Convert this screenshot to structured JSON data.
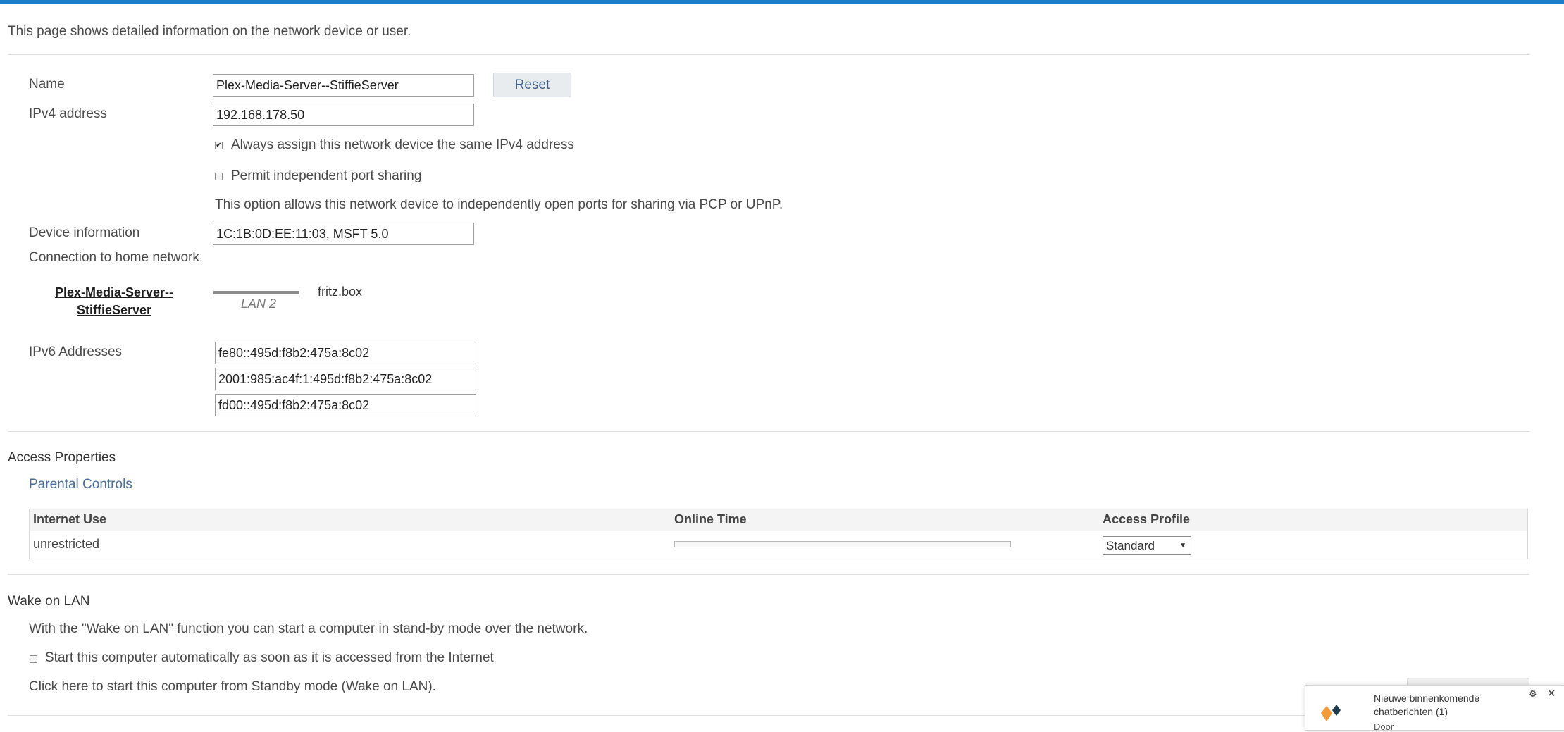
{
  "intro": "This page shows detailed information on the network device or user.",
  "name": {
    "label": "Name",
    "value": "Plex-Media-Server--StiffieServer",
    "reset_label": "Reset"
  },
  "ipv4": {
    "label": "IPv4 address",
    "value": "192.168.178.50",
    "always_assign_label": "Always assign this network device the same IPv4 address",
    "always_assign_checked": true,
    "permit_sharing_label": "Permit independent port sharing",
    "permit_sharing_checked": false,
    "permit_sharing_help": "This option allows this network device to independently open ports for sharing via PCP or UPnP."
  },
  "device_info": {
    "label": "Device information",
    "value": "1C:1B:0D:EE:11:03, MSFT 5.0"
  },
  "connection": {
    "label": "Connection to home network",
    "device_line1": "Plex-Media-Server--",
    "device_line2": "StiffieServer",
    "port": "LAN 2",
    "router": "fritz.box"
  },
  "ipv6": {
    "label": "IPv6 Addresses",
    "addresses": [
      "fe80::495d:f8b2:475a:8c02",
      "2001:985:ac4f:1:495d:f8b2:475a:8c02",
      "fd00::495d:f8b2:475a:8c02"
    ]
  },
  "access": {
    "title": "Access Properties",
    "parental_link": "Parental Controls",
    "columns": [
      "Internet Use",
      "Online Time",
      "Access Profile"
    ],
    "row": {
      "internet_use": "unrestricted",
      "online_time_fraction": 0,
      "profile": "Standard"
    }
  },
  "wol": {
    "title": "Wake on LAN",
    "description": "With the \"Wake on LAN\" function you can start a computer in stand-by mode over the network.",
    "auto_start_label": "Start this computer automatically as soon as it is accessed from the Internet",
    "auto_start_checked": false,
    "click_here": "Click here to start this computer from Standby mode (Wake on LAN)."
  },
  "notification": {
    "title_line1": "Nieuwe binnenkomende",
    "title_line2": "chatberichten (1)",
    "extra": "Door",
    "icons": [
      "settings-gear-icon",
      "close-icon",
      "app-logo-icon"
    ]
  },
  "colors": {
    "accent_bar": "#1a7fd1",
    "link": "#4a6f9e"
  }
}
